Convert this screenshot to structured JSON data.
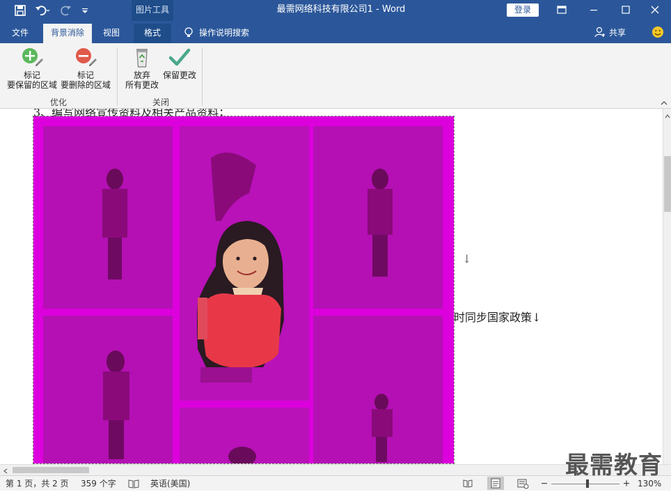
{
  "window": {
    "title": "最需网络科技有限公司1  -  Word",
    "context_tab_group": "图片工具",
    "login_label": "登录"
  },
  "tabs": [
    {
      "label": "文件",
      "active": false
    },
    {
      "label": "背景消除",
      "active": true
    },
    {
      "label": "视图",
      "active": false
    },
    {
      "label": "格式",
      "active": false
    }
  ],
  "tell_me": "操作说明搜索",
  "share_label": "共享",
  "ribbon": {
    "groups": [
      {
        "label": "优化",
        "buttons": [
          {
            "label_line1": "标记",
            "label_line2": "要保留的区域",
            "icon": "plus-circle-pencil-icon"
          },
          {
            "label_line1": "标记",
            "label_line2": "要删除的区域",
            "icon": "minus-circle-pencil-icon"
          }
        ]
      },
      {
        "label": "关闭",
        "buttons": [
          {
            "label_line1": "放弃",
            "label_line2": "所有更改",
            "icon": "recycle-bin-icon"
          },
          {
            "label_line1": "保留更改",
            "label_line2": "",
            "icon": "checkmark-icon"
          }
        ]
      }
    ]
  },
  "document": {
    "partial_top_line": "3、编写网络宣传资料及相关产品资料；",
    "right_fragment_1": "↓",
    "right_fragment_2": "时同步国家政策↓"
  },
  "status": {
    "page": "第 1 页，共 2 页",
    "words": "359 个字",
    "language": "英语(美国)",
    "zoom": "130%"
  },
  "watermark": "最需教育",
  "colors": {
    "brand": "#2b579a",
    "removal_overlay": "#e000e0",
    "keep_green": "#5cb85c",
    "remove_red": "#e05a4a"
  }
}
